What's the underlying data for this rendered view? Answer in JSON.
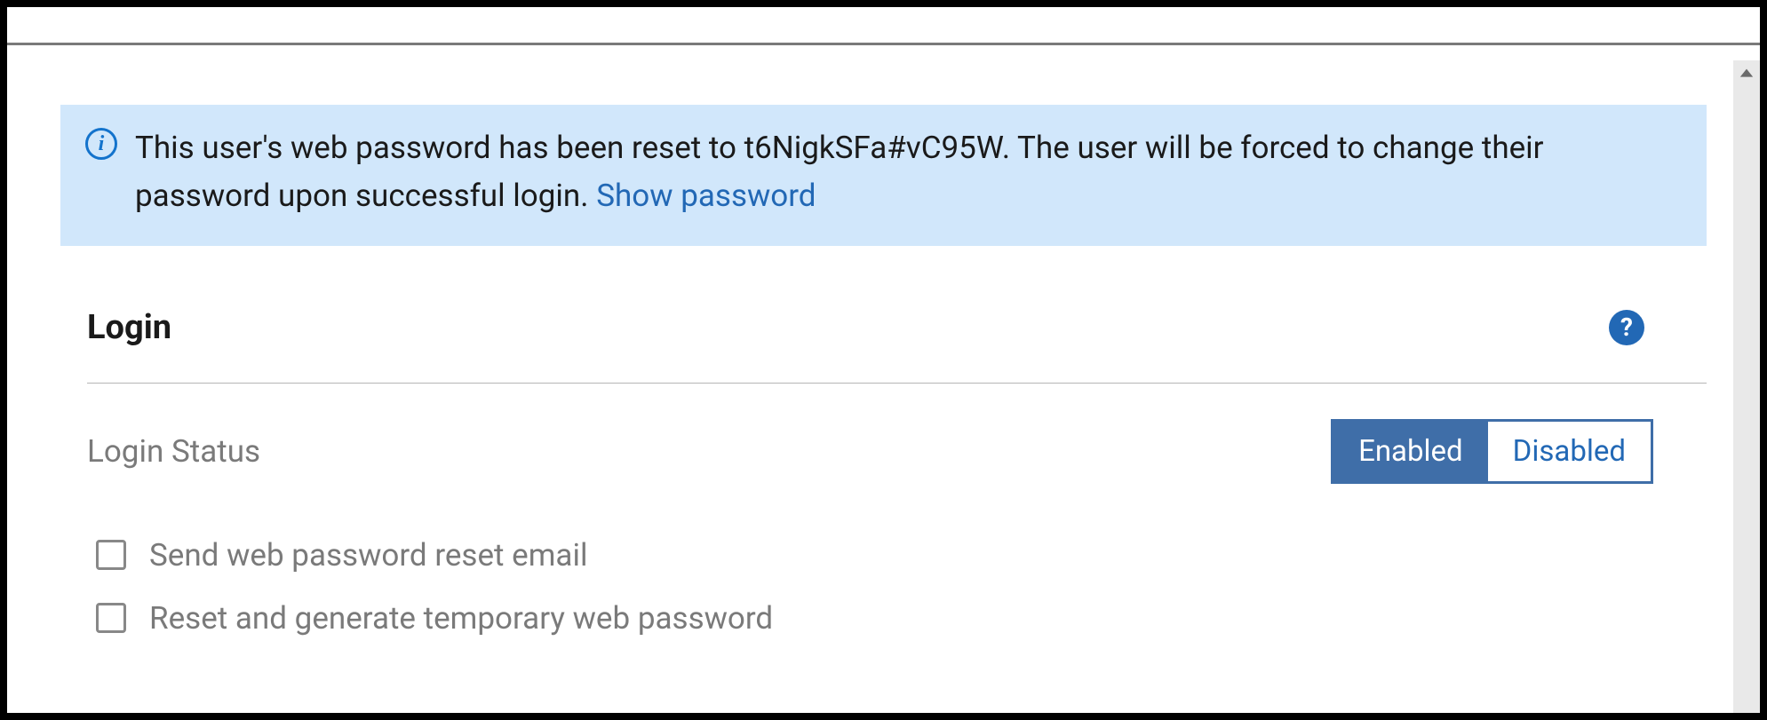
{
  "banner": {
    "message_prefix": "This user's web password has been reset to ",
    "password": "t6NigkSFa#vC95W",
    "message_suffix": ". The user will be forced to change their password upon successful login. ",
    "link_text": "Show password"
  },
  "section": {
    "title": "Login"
  },
  "login_status": {
    "label": "Login Status",
    "enabled_label": "Enabled",
    "disabled_label": "Disabled",
    "active": "enabled"
  },
  "options": {
    "send_reset_email": "Send web password reset email",
    "generate_temp": "Reset and generate temporary web password"
  }
}
